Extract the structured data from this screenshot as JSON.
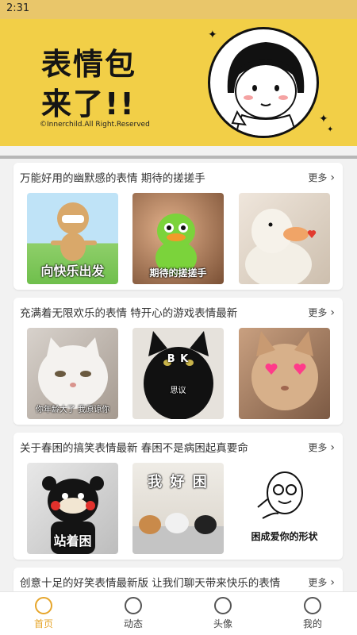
{
  "status": {
    "time": "2:31"
  },
  "banner": {
    "line1": "表情包",
    "line2": "来了!!",
    "copyright": "©Innerchild.All Right.Reserved"
  },
  "cards": [
    {
      "title": "万能好用的幽默感的表情 期待的搓搓手",
      "more": "更多",
      "thumbs": [
        {
          "caption": "向快乐出发"
        },
        {
          "caption": "期待的搓搓手"
        },
        {
          "caption": ""
        }
      ]
    },
    {
      "title": "充满着无限欢乐的表情 特开心的游戏表情最新",
      "more": "更多",
      "thumbs": [
        {
          "caption": "你年龄大了 我原谅你"
        },
        {
          "caption": "思议",
          "letters": "B  K"
        },
        {
          "caption": ""
        }
      ]
    },
    {
      "title": "关于春困的搞笑表情最新 春困不是病困起真要命",
      "more": "更多",
      "thumbs": [
        {
          "caption": "站着困"
        },
        {
          "caption": "我 好 困"
        },
        {
          "caption": "困成爱你的形状"
        }
      ]
    },
    {
      "title": "创意十足的好笑表情最新版 让我们聊天带来快乐的表情",
      "more": "更多"
    }
  ],
  "tabs": [
    {
      "label": "首页",
      "icon": "smile-icon",
      "active": true
    },
    {
      "label": "动态",
      "icon": "planet-icon",
      "active": false
    },
    {
      "label": "头像",
      "icon": "face-icon",
      "active": false
    },
    {
      "label": "我的",
      "icon": "user-icon",
      "active": false
    }
  ],
  "colors": {
    "accent": "#e6a52a",
    "banner": "#f2cf47"
  }
}
